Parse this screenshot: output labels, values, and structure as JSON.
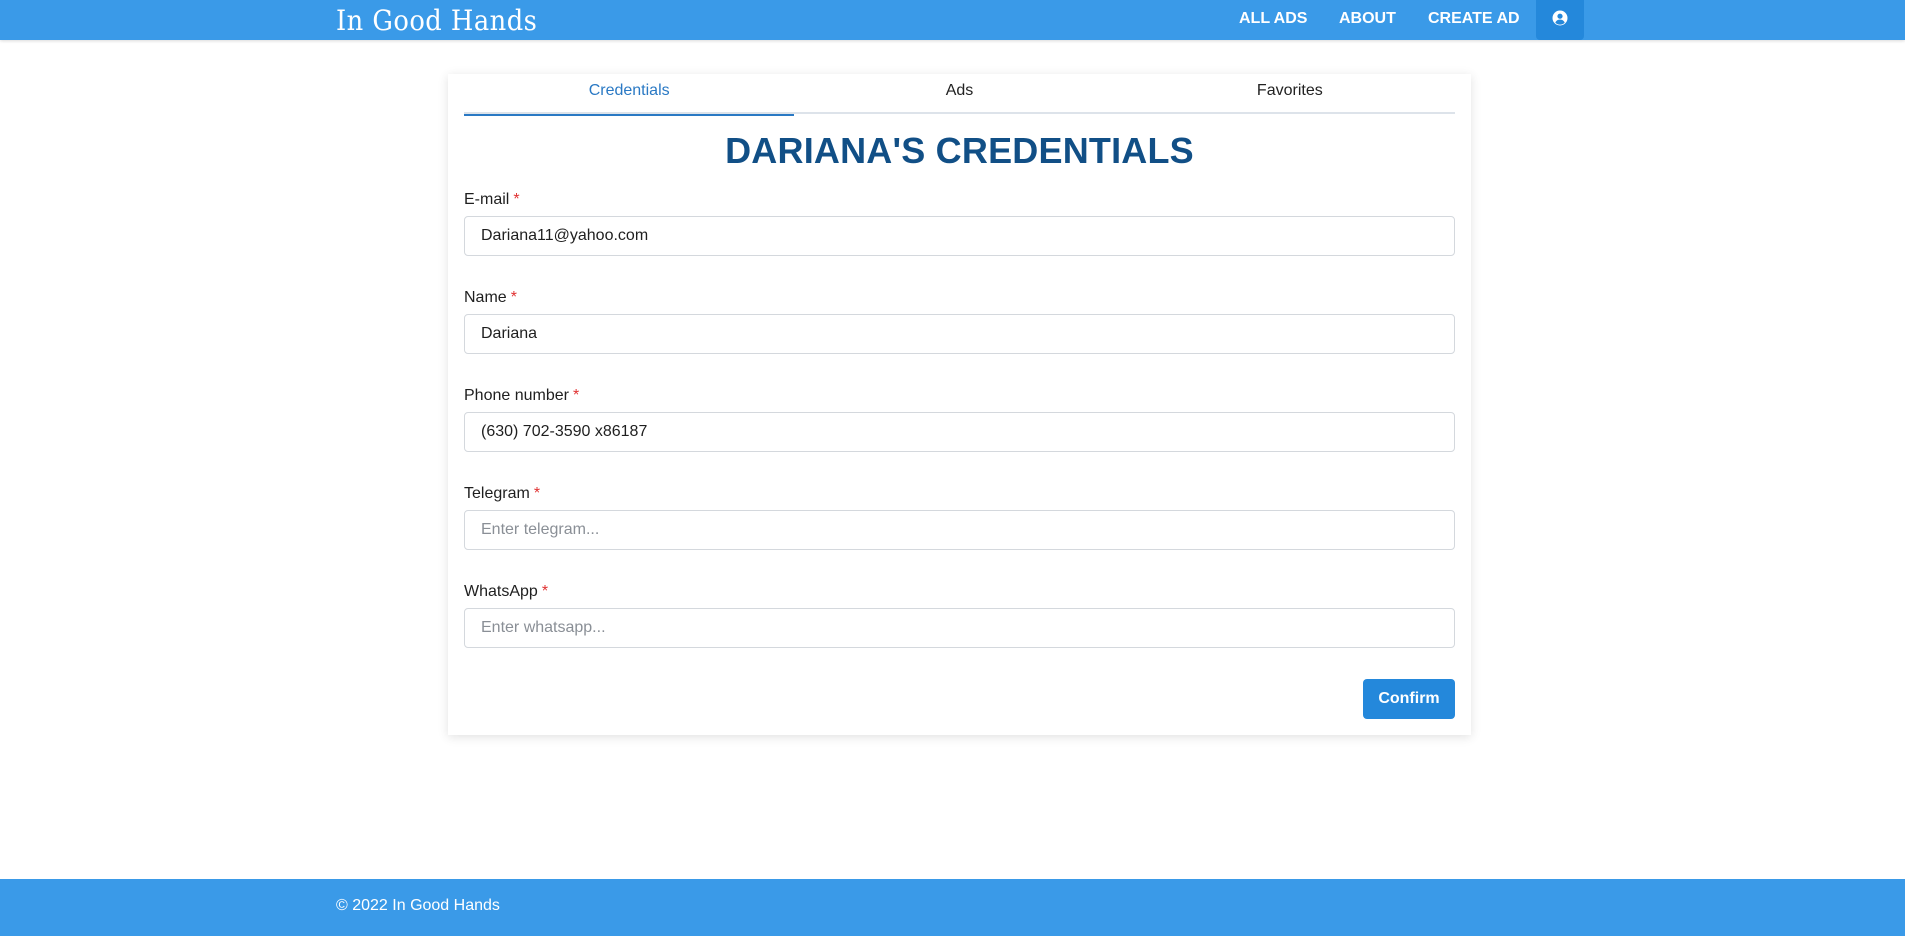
{
  "header": {
    "brand": "In Good Hands",
    "nav": {
      "all_ads": "ALL ADS",
      "about": "ABOUT",
      "create_ad": "CREATE AD"
    },
    "user_icon": "user-circle-icon"
  },
  "tabs": [
    {
      "label": "Credentials",
      "active": true
    },
    {
      "label": "Ads",
      "active": false
    },
    {
      "label": "Favorites",
      "active": false
    }
  ],
  "form": {
    "title": "DARIANA'S CREDENTIALS",
    "required_mark": "*",
    "fields": [
      {
        "label": "E-mail",
        "value": "Dariana11@yahoo.com",
        "placeholder": ""
      },
      {
        "label": "Name",
        "value": "Dariana",
        "placeholder": ""
      },
      {
        "label": "Phone number",
        "value": "(630) 702-3590 x86187",
        "placeholder": ""
      },
      {
        "label": "Telegram",
        "value": "",
        "placeholder": "Enter telegram..."
      },
      {
        "label": "WhatsApp",
        "value": "",
        "placeholder": "Enter whatsapp..."
      }
    ],
    "confirm_label": "Confirm"
  },
  "footer": {
    "text": "© 2022 In Good Hands"
  },
  "colors": {
    "primary": "#3a9ae8",
    "button": "#2488db",
    "heading": "#114f86",
    "active_tab": "#2a79c4",
    "required": "#e03131"
  }
}
